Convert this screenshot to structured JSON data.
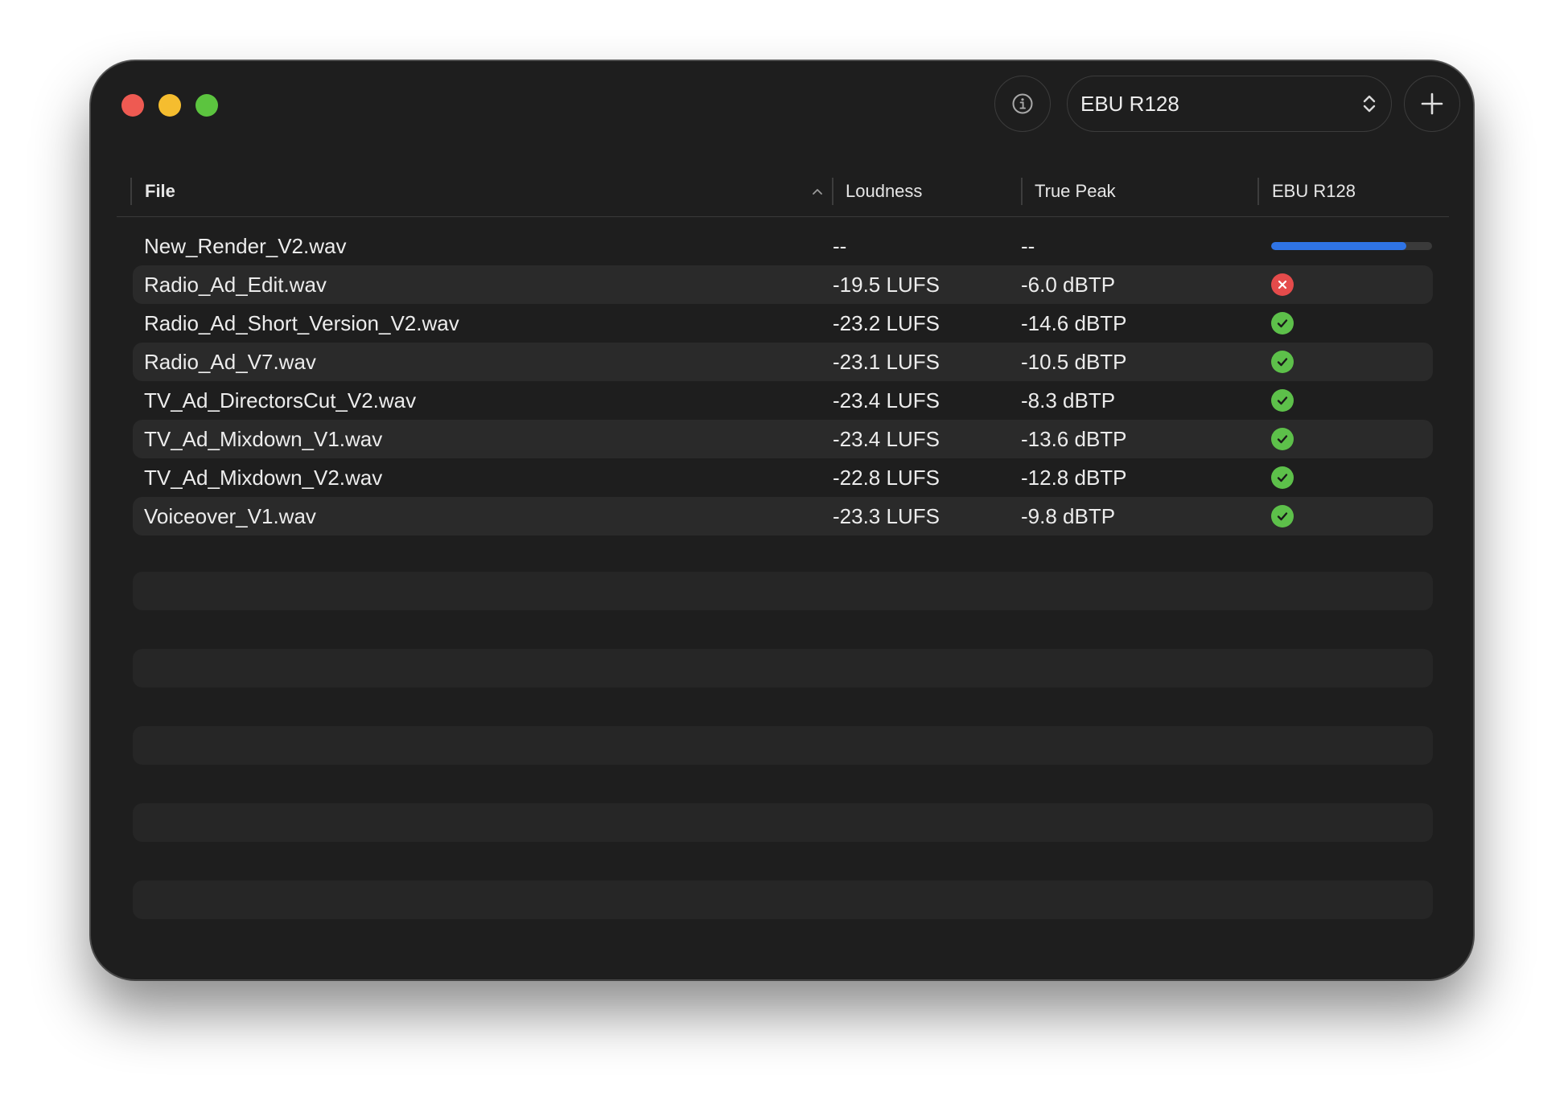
{
  "toolbar": {
    "standard_label": "EBU R128",
    "info_icon": "info-circle-icon",
    "add_icon": "plus-icon",
    "select_icon": "chevron-up-down-icon"
  },
  "columns": {
    "file": "File",
    "loudness": "Loudness",
    "true_peak": "True Peak",
    "standard": "EBU R128",
    "sort": "ascending"
  },
  "colors": {
    "window_bg": "#1e1e1e",
    "alt_row": "#2a2a2a",
    "pass": "#5dc04a",
    "fail": "#e54b4b",
    "progress": "#2f74e6"
  },
  "files": [
    {
      "name": "New_Render_V2.wav",
      "loudness": "--",
      "true_peak": "--",
      "status": "analyzing",
      "progress": 0.84
    },
    {
      "name": "Radio_Ad_Edit.wav",
      "loudness": "-19.5 LUFS",
      "true_peak": "-6.0 dBTP",
      "status": "fail"
    },
    {
      "name": "Radio_Ad_Short_Version_V2.wav",
      "loudness": "-23.2 LUFS",
      "true_peak": "-14.6 dBTP",
      "status": "pass"
    },
    {
      "name": "Radio_Ad_V7.wav",
      "loudness": "-23.1 LUFS",
      "true_peak": "-10.5 dBTP",
      "status": "pass"
    },
    {
      "name": "TV_Ad_DirectorsCut_V2.wav",
      "loudness": "-23.4 LUFS",
      "true_peak": "-8.3 dBTP",
      "status": "pass"
    },
    {
      "name": "TV_Ad_Mixdown_V1.wav",
      "loudness": "-23.4 LUFS",
      "true_peak": "-13.6 dBTP",
      "status": "pass"
    },
    {
      "name": "TV_Ad_Mixdown_V2.wav",
      "loudness": "-22.8 LUFS",
      "true_peak": "-12.8 dBTP",
      "status": "pass"
    },
    {
      "name": "Voiceover_V1.wav",
      "loudness": "-23.3 LUFS",
      "true_peak": "-9.8 dBTP",
      "status": "pass"
    }
  ]
}
